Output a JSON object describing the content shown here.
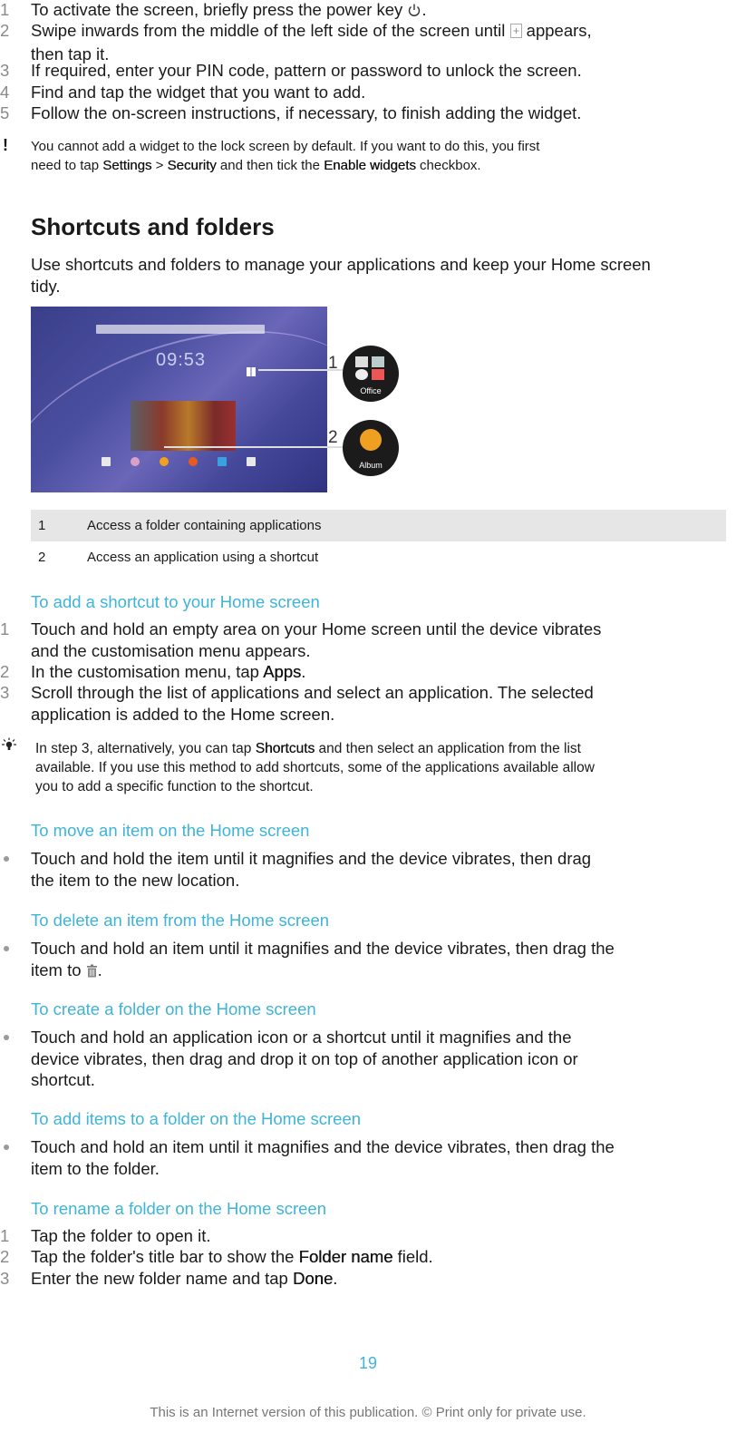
{
  "intro_steps": [
    {
      "num": "1",
      "text_before": "To activate the screen, briefly press the power key ",
      "icon": "power-icon",
      "text_after": "."
    },
    {
      "num": "2",
      "text_before": "Swipe inwards from the middle of the left side of the screen until ",
      "icon": "add-widget-icon",
      "text_after": " appears,",
      "line2": "then tap it."
    },
    {
      "num": "3",
      "text": "If required, enter your PIN code, pattern or password to unlock the screen."
    },
    {
      "num": "4",
      "text": "Find and tap the widget that you want to add."
    },
    {
      "num": "5",
      "text": "Follow the on-screen instructions, if necessary, to finish adding the widget."
    }
  ],
  "warning_note": {
    "icon": "exclamation-icon",
    "part1": "You cannot add a widget to the lock screen by default. If you want to do this, you first",
    "part2": "need to tap ",
    "settings": "Settings",
    "sep": " > ",
    "security": "Security",
    "part3": " and then tick the ",
    "enable": "Enable widgets",
    "part4": " checkbox."
  },
  "section": {
    "title": "Shortcuts and folders",
    "intro_line1": "Use shortcuts and folders to manage your applications and keep your Home screen",
    "intro_line2": "tidy."
  },
  "figure": {
    "clock": "09:53",
    "callout1": "1",
    "callout2": "2",
    "circle1_label": "Office",
    "circle2_label": "Album"
  },
  "legend": [
    {
      "num": "1",
      "text": "Access a folder containing applications"
    },
    {
      "num": "2",
      "text": "Access an application using a shortcut"
    }
  ],
  "add_shortcut": {
    "heading": "To add a shortcut to your Home screen",
    "steps": [
      {
        "num": "1",
        "line1": "Touch and hold an empty area on your Home screen until the device vibrates",
        "line2": "and the customisation menu appears."
      },
      {
        "num": "2",
        "before": "In the customisation menu, tap ",
        "bold": "Apps",
        "after": "."
      },
      {
        "num": "3",
        "line1": "Scroll through the list of applications and select an application. The selected",
        "line2": "application is added to the Home screen."
      }
    ],
    "tip": {
      "icon": "lightbulb-icon",
      "before": "In step 3, alternatively, you can tap ",
      "bold": "Shortcuts",
      "after": " and then select an application from the list",
      "line2": "available. If you use this method to add shortcuts, some of the applications available allow",
      "line3": "you to add a specific function to the shortcut."
    }
  },
  "move_item": {
    "heading": "To move an item on the Home screen",
    "line1": "Touch and hold the item until it magnifies and the device vibrates, then drag",
    "line2": "the item to the new location."
  },
  "delete_item": {
    "heading": "To delete an item from the Home screen",
    "line1": "Touch and hold an item until it magnifies and the device vibrates, then drag the",
    "line2_before": "item to ",
    "icon": "trash-icon",
    "line2_after": "."
  },
  "create_folder": {
    "heading": "To create a folder on the Home screen",
    "line1": "Touch and hold an application icon or a shortcut until it magnifies and the",
    "line2": "device vibrates, then drag and drop it on top of another application icon or",
    "line3": "shortcut."
  },
  "add_to_folder": {
    "heading": "To add items to a folder on the Home screen",
    "line1": "Touch and hold an item until it magnifies and the device vibrates, then drag the",
    "line2": "item to the folder."
  },
  "rename_folder": {
    "heading": "To rename a folder on the Home screen",
    "steps": [
      {
        "num": "1",
        "text": "Tap the folder to open it."
      },
      {
        "num": "2",
        "before": "Tap the folder's title bar to show the ",
        "bold": "Folder name",
        "after": " field."
      },
      {
        "num": "3",
        "before": "Enter the new folder name and tap ",
        "bold": "Done",
        "after": "."
      }
    ]
  },
  "footer": {
    "page_number": "19",
    "note": "This is an Internet version of this publication. © Print only for private use."
  },
  "colors": {
    "heading_accent": "#3eb4d8",
    "legend_shade": "#e6e6e6"
  }
}
